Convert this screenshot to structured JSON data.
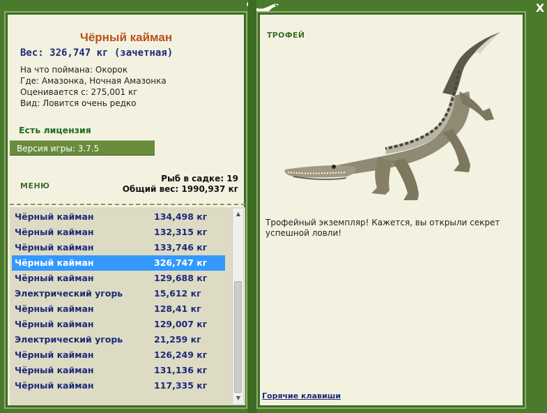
{
  "fish": {
    "title": "Чёрный кайман",
    "weight": "Вес: 326,747 кг (зачетная)",
    "bait": "На что поймана: Окорок",
    "location": "Где: Амазонка, Ночная Амазонка",
    "rated": "Оценивается с: 275,001 кг",
    "kind": "Вид: Ловится очень редко"
  },
  "license": "Есть лицензия",
  "version": "Версия игры: 3.7.5",
  "menu_label": "МЕНЮ",
  "keepnet": {
    "count": "Рыб в садке: 19",
    "total": "Общий вес: 1990,937 кг"
  },
  "list": [
    {
      "name": "Чёрный кайман",
      "weight": "134,498 кг"
    },
    {
      "name": "Чёрный кайман",
      "weight": "132,315 кг"
    },
    {
      "name": "Чёрный кайман",
      "weight": "133,746 кг"
    },
    {
      "name": "Чёрный кайман",
      "weight": "326,747 кг"
    },
    {
      "name": "Чёрный кайман",
      "weight": "129,688 кг"
    },
    {
      "name": "Электрический угорь",
      "weight": "15,612 кг"
    },
    {
      "name": "Чёрный кайман",
      "weight": "128,41 кг"
    },
    {
      "name": "Чёрный кайман",
      "weight": "129,007 кг"
    },
    {
      "name": "Электрический угорь",
      "weight": "21,259 кг"
    },
    {
      "name": "Чёрный кайман",
      "weight": "126,249 кг"
    },
    {
      "name": "Чёрный кайман",
      "weight": "131,136 кг"
    },
    {
      "name": "Чёрный кайман",
      "weight": "117,335 кг"
    }
  ],
  "selected_index": 3,
  "trophy_label": "ТРОФЕЙ",
  "trophy_text": "Трофейный экземпляр! Кажется, вы открыли секрет успешной ловли!",
  "hotkeys": "Горячие клавиши",
  "close_label": "X",
  "icons": {
    "close": "close-icon",
    "gecko": "gecko-icon",
    "scroll_up": "chevron-up-icon",
    "scroll_down": "chevron-down-icon"
  },
  "colors": {
    "frame": "#4a7a2c",
    "panel": "#f3f2e1",
    "title": "#b8501c",
    "text_blue": "#1c2a78",
    "selection": "#3399ff"
  }
}
